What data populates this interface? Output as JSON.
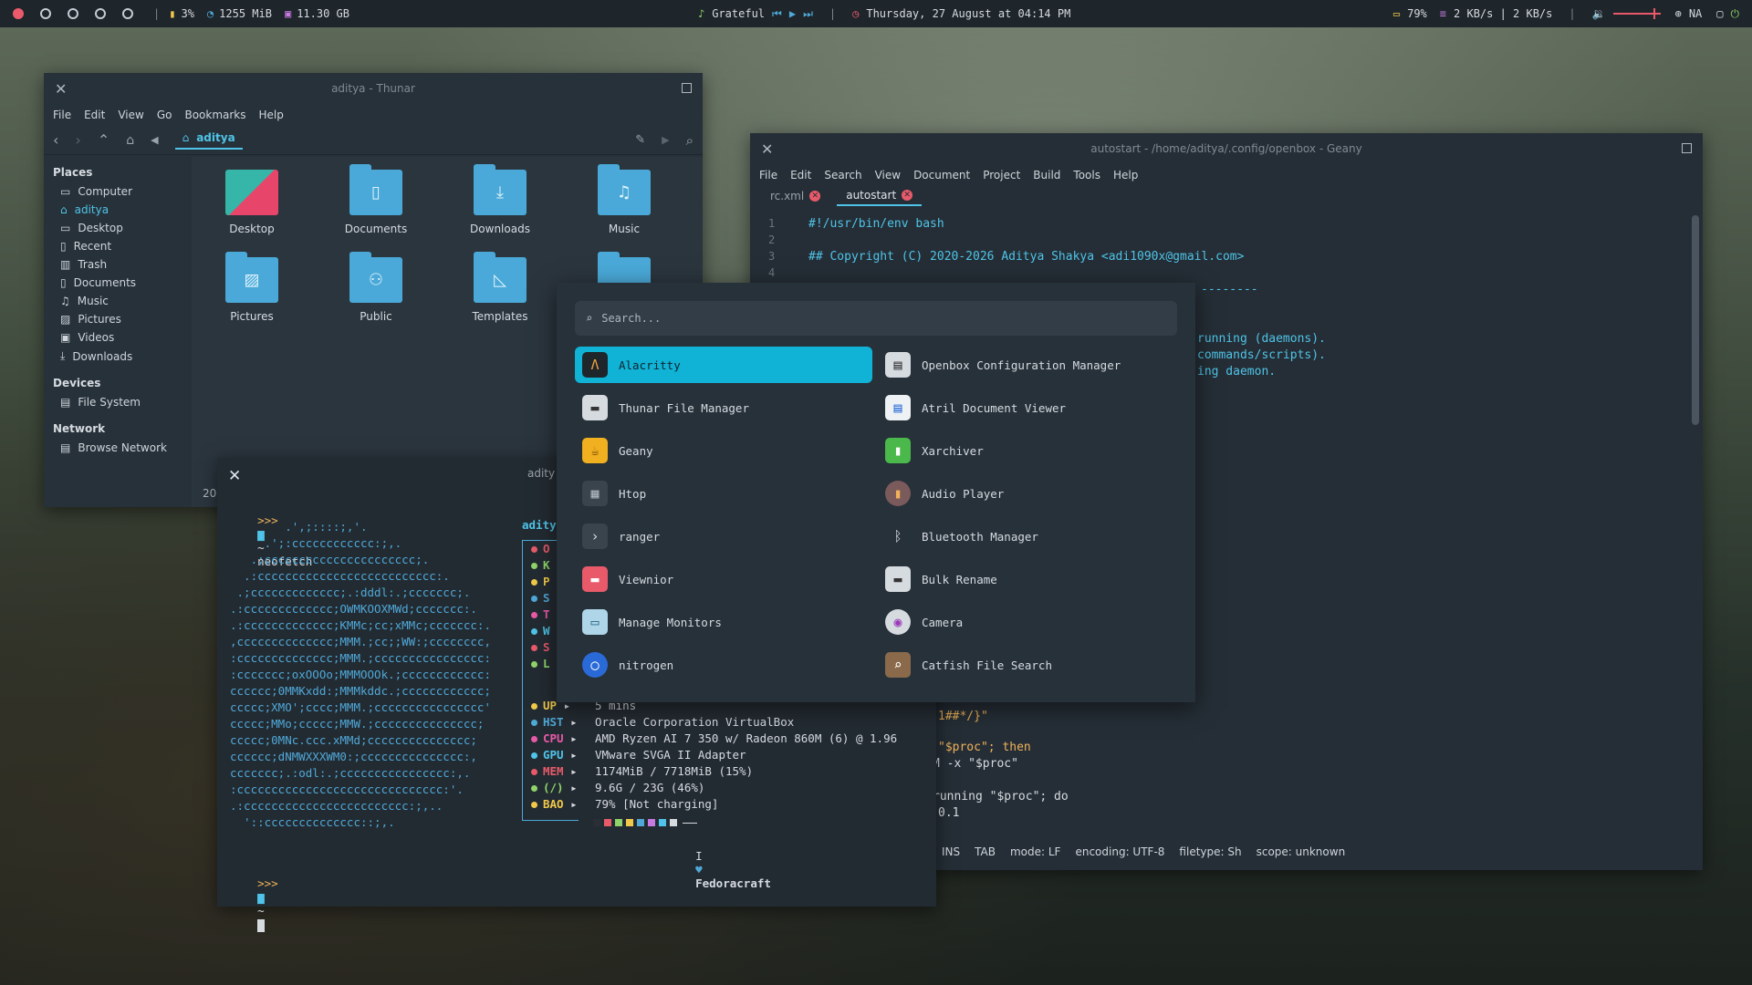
{
  "topbar": {
    "cpu": "3%",
    "mem": "1255 MiB",
    "disk": "11.30 GB",
    "song": "Grateful",
    "datetime": "Thursday, 27 August at 04:14 PM",
    "battery": "79%",
    "net": "2 KB/s | 2 KB/s",
    "network_status": "NA",
    "volume_level": 0.85
  },
  "thunar": {
    "title": "aditya - Thunar",
    "menu": [
      "File",
      "Edit",
      "View",
      "Go",
      "Bookmarks",
      "Help"
    ],
    "location": "aditya",
    "places_header": "Places",
    "places": [
      "Computer",
      "aditya",
      "Desktop",
      "Recent",
      "Trash",
      "Documents",
      "Music",
      "Pictures",
      "Videos",
      "Downloads"
    ],
    "devices_header": "Devices",
    "devices": [
      "File System"
    ],
    "network_header": "Network",
    "network": [
      "Browse Network"
    ],
    "files": [
      "Desktop",
      "Documents",
      "Downloads",
      "Music",
      "Pictures",
      "Public",
      "Templates"
    ],
    "status_fragment": "20"
  },
  "geany": {
    "title": "autostart - /home/aditya/.config/openbox - Geany",
    "menu": [
      "File",
      "Edit",
      "Search",
      "View",
      "Document",
      "Project",
      "Build",
      "Tools",
      "Help"
    ],
    "tabs": [
      "rc.xml",
      "autostart"
    ],
    "lines": [
      {
        "n": "1",
        "text": "#!/usr/bin/env bash"
      },
      {
        "n": "3",
        "text": "## Copyright (C) 2020-2026 Aditya Shakya <adi1090x@gmail.com>"
      }
    ],
    "fragments": [
      "--------",
      "running (daemons).",
      "commands/scripts).",
      "ing daemon.",
      "1##*/}\"",
      "\"$proc\"; then",
      "M -x \"$proc\"",
      "running \"$proc\"; do",
      "0.1"
    ],
    "line_numbers_partial": [
      "2",
      "4"
    ],
    "status": [
      "INS",
      "TAB",
      "mode: LF",
      "encoding: UTF-8",
      "filetype: Sh",
      "scope: unknown"
    ]
  },
  "terminal": {
    "title": "adity",
    "prompt": ">>>",
    "command": "neofetch",
    "home": "~",
    "ascii": [
      "        .',;::::;,'.",
      "     .';:cccccccccccc:;,.",
      "   .;cccccccccccccccccccccc;.",
      "  .:cccccccccccccccccccccccccc:.",
      " .;ccccccccccccc;.:dddl:.;ccccccc;.",
      ".:ccccccccccccc;OWMKOOXMWd;ccccccc:.",
      ".:ccccccccccccc;KMMc;cc;xMMc;ccccccc:.",
      ",cccccccccccccc;MMM.;cc;;WW:;cccccccc,",
      ":cccccccccccccc;MMM.;cccccccccccccccc:",
      ":ccccccc;oxOOOo;MMMOOOk.;cccccccccccc:",
      "cccccc;0MMKxdd:;MMMkddc.;cccccccccccc;",
      "ccccc;XMO';cccc;MMM.;cccccccccccccccc'",
      "ccccc;MMo;ccccc;MMW.;ccccccccccccccc;",
      "ccccc;0MNc.ccc.xMMd;ccccccccccccccc;",
      "cccccc;dNMWXXXWM0:;ccccccccccccccc:,",
      "ccccccc;.:odl:.;cccccccccccccccc:,.",
      ":cccccccccccccccccccccccccccccc:'.",
      ".:cccccccccccccccccccccccc:;,..",
      "  '::cccccccccccccc::;,."
    ],
    "user_label": "adity",
    "info_partial_labels": [
      "O",
      "K",
      "P",
      "S",
      "T",
      "W",
      "S",
      "L"
    ],
    "info": [
      {
        "label": "UP",
        "value": "5 mins",
        "color": "#f0c94a"
      },
      {
        "label": "HST",
        "value": "Oracle Corporation VirtualBox",
        "color": "#4fa8d8"
      },
      {
        "label": "CPU",
        "value": "AMD Ryzen AI 7 350 w/ Radeon 860M (6) @ 1.96",
        "color": "#e85aa8"
      },
      {
        "label": "GPU",
        "value": "VMware SVGA II Adapter",
        "color": "#4fc4e8"
      },
      {
        "label": "MEM",
        "value": "1174MiB / 7718MiB (15%)",
        "color": "#e85a6a"
      },
      {
        "label": "(/)",
        "value": "9.6G / 23G (46%)",
        "color": "#8fd46a"
      },
      {
        "label": "BAO",
        "value": "79% [Not charging]",
        "color": "#f0c94a"
      }
    ],
    "credit_prefix": "I",
    "credit_name": "Fedoracraft",
    "palette": [
      "#2a2f35",
      "#e85a6a",
      "#8fd46a",
      "#f0c94a",
      "#4fa8d8",
      "#c77ae0",
      "#4fc4e8",
      "#d6dbe0"
    ]
  },
  "launcher": {
    "search_placeholder": "Search...",
    "apps_left": [
      "Alacritty",
      "Thunar File Manager",
      "Geany",
      "Htop",
      "ranger",
      "Viewnior",
      "Manage Monitors",
      "nitrogen"
    ],
    "apps_right": [
      "Openbox Configuration Manager",
      "Atril Document Viewer",
      "Xarchiver",
      "Audio Player",
      "Bluetooth Manager",
      "Bulk Rename",
      "Camera",
      "Catfish File Search"
    ],
    "selected": "Alacritty"
  }
}
